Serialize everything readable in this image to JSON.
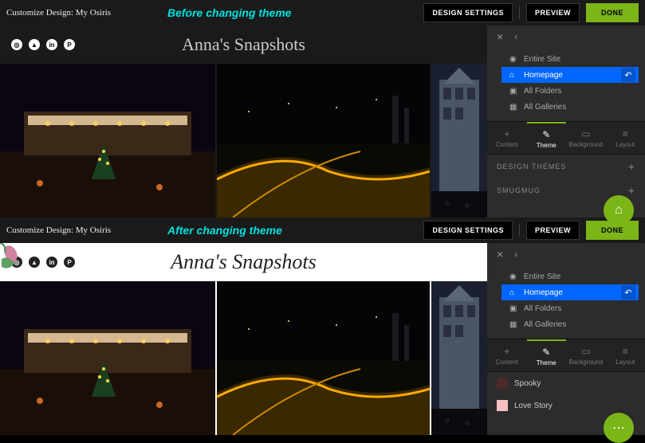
{
  "before": {
    "annotation": "Before changing theme",
    "topbar": {
      "title": "Customize Design: My Osiris",
      "design_settings": "DESIGN SETTINGS",
      "preview": "PREVIEW",
      "done": "DONE"
    },
    "site_title": "Anna's Snapshots",
    "tree": {
      "entire_site": "Entire Site",
      "homepage": "Homepage",
      "all_folders": "All Folders",
      "all_galleries": "All Galleries"
    },
    "tabs": {
      "content": "Content",
      "theme": "Theme",
      "background": "Background",
      "layout": "Layout"
    },
    "sections": {
      "design_themes": "DESIGN THEMES",
      "smugmug": "SMUGMUG"
    }
  },
  "after": {
    "annotation": "After changing theme",
    "topbar": {
      "title": "Customize Design: My Osiris",
      "design_settings": "DESIGN SETTINGS",
      "preview": "PREVIEW",
      "done": "DONE"
    },
    "site_title": "Anna's Snapshots",
    "tree": {
      "entire_site": "Entire Site",
      "homepage": "Homepage",
      "all_folders": "All Folders",
      "all_galleries": "All Galleries"
    },
    "tabs": {
      "content": "Content",
      "theme": "Theme",
      "background": "Background",
      "layout": "Layout"
    },
    "themes": {
      "spooky": "Spooky",
      "love_story": "Love Story"
    }
  },
  "social_icons": [
    "ig",
    "fb",
    "in",
    "p"
  ]
}
